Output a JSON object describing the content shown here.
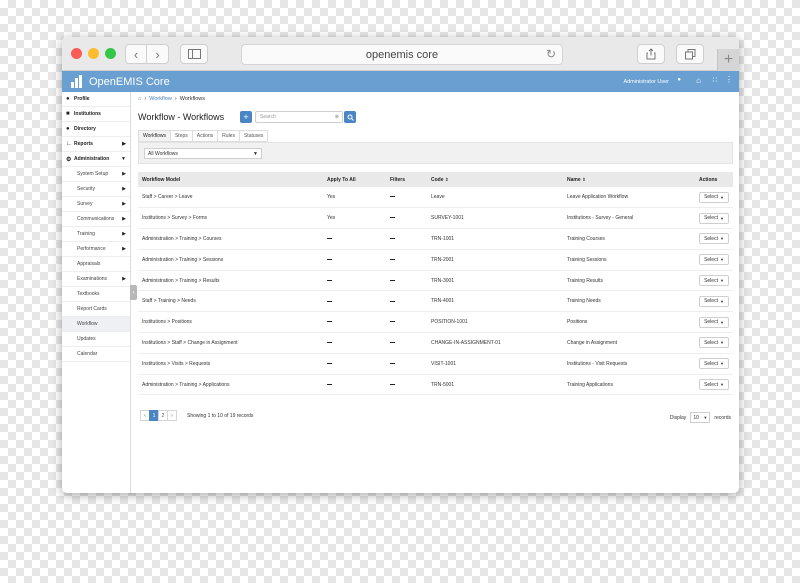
{
  "browser": {
    "url": "openemis core",
    "back_icon": "chevron-left-icon",
    "forward_icon": "chevron-right-icon",
    "sidebar_icon": "sidebar-icon",
    "reload_icon": "reload-icon",
    "share_icon": "share-icon",
    "tabs_icon": "tabs-icon",
    "new_tab_icon": "plus-icon"
  },
  "header": {
    "title": "OpenEMIS Core",
    "user": "Administrator User",
    "bg_color": "#6a9fd1"
  },
  "sidebar": {
    "items": [
      {
        "label": "Profile",
        "icon": "user-icon"
      },
      {
        "label": "Institutions",
        "icon": "building-icon"
      },
      {
        "label": "Directory",
        "icon": "users-icon"
      },
      {
        "label": "Reports",
        "icon": "chart-icon"
      },
      {
        "label": "Administration",
        "icon": "cogs-icon"
      }
    ],
    "sub_items": [
      {
        "label": "System Setup"
      },
      {
        "label": "Security"
      },
      {
        "label": "Survey"
      },
      {
        "label": "Communications"
      },
      {
        "label": "Training"
      },
      {
        "label": "Performance"
      },
      {
        "label": "Appraisals"
      },
      {
        "label": "Examinations"
      },
      {
        "label": "Textbooks"
      },
      {
        "label": "Report Cards"
      },
      {
        "label": "Workflow"
      },
      {
        "label": "Updates"
      },
      {
        "label": "Calendar"
      }
    ]
  },
  "breadcrumb": {
    "home_icon": "home-icon",
    "level1": "Workflow",
    "level2": "Workflows"
  },
  "page": {
    "title": "Workflow - Workflows",
    "search_placeholder": "Search",
    "tabs": [
      "Workflows",
      "Steps",
      "Actions",
      "Rules",
      "Statuses"
    ],
    "filter_value": "All Workflows"
  },
  "table": {
    "headers": [
      "Workflow Model",
      "Apply To All",
      "Filters",
      "Code",
      "Name",
      "Actions"
    ],
    "rows": [
      {
        "model": "Staff > Career > Leave",
        "apply": "Yes",
        "code": "Leave",
        "name": "Leave Application Workflow",
        "action": "Select"
      },
      {
        "model": "Institutions > Survey > Forms",
        "apply": "Yes",
        "code": "SURVEY-1001",
        "name": "Institutions - Survey - General",
        "action": "Select"
      },
      {
        "model": "Administration > Training > Courses",
        "apply": "",
        "code": "TRN-1001",
        "name": "Training Courses",
        "action": "Select"
      },
      {
        "model": "Administration > Training > Sessions",
        "apply": "",
        "code": "TRN-2001",
        "name": "Training Sessions",
        "action": "Select"
      },
      {
        "model": "Administration > Training > Results",
        "apply": "",
        "code": "TRN-3001",
        "name": "Training Results",
        "action": "Select"
      },
      {
        "model": "Staff > Training > Needs",
        "apply": "",
        "code": "TRN-4001",
        "name": "Training Needs",
        "action": "Select"
      },
      {
        "model": "Institutions > Positions",
        "apply": "",
        "code": "POSITION-1001",
        "name": "Positions",
        "action": "Select"
      },
      {
        "model": "Institutions > Staff > Change in Assignment",
        "apply": "",
        "code": "CHANGE-IN-ASSIGNMENT-01",
        "name": "Change in Assignment",
        "action": "Select"
      },
      {
        "model": "Institutions > Visits > Requests",
        "apply": "",
        "code": "VISIT-1001",
        "name": "Institutions - Visit Requests",
        "action": "Select"
      },
      {
        "model": "Administration > Training > Applications",
        "apply": "",
        "code": "TRN-5001",
        "name": "Training Applications",
        "action": "Select"
      }
    ]
  },
  "pagination": {
    "prev": "‹",
    "pages": [
      "1",
      "2"
    ],
    "next": "›",
    "info": "Showing 1 to 10 of 19 records",
    "display_label": "Display",
    "display_value": "10",
    "records_label": "records"
  }
}
